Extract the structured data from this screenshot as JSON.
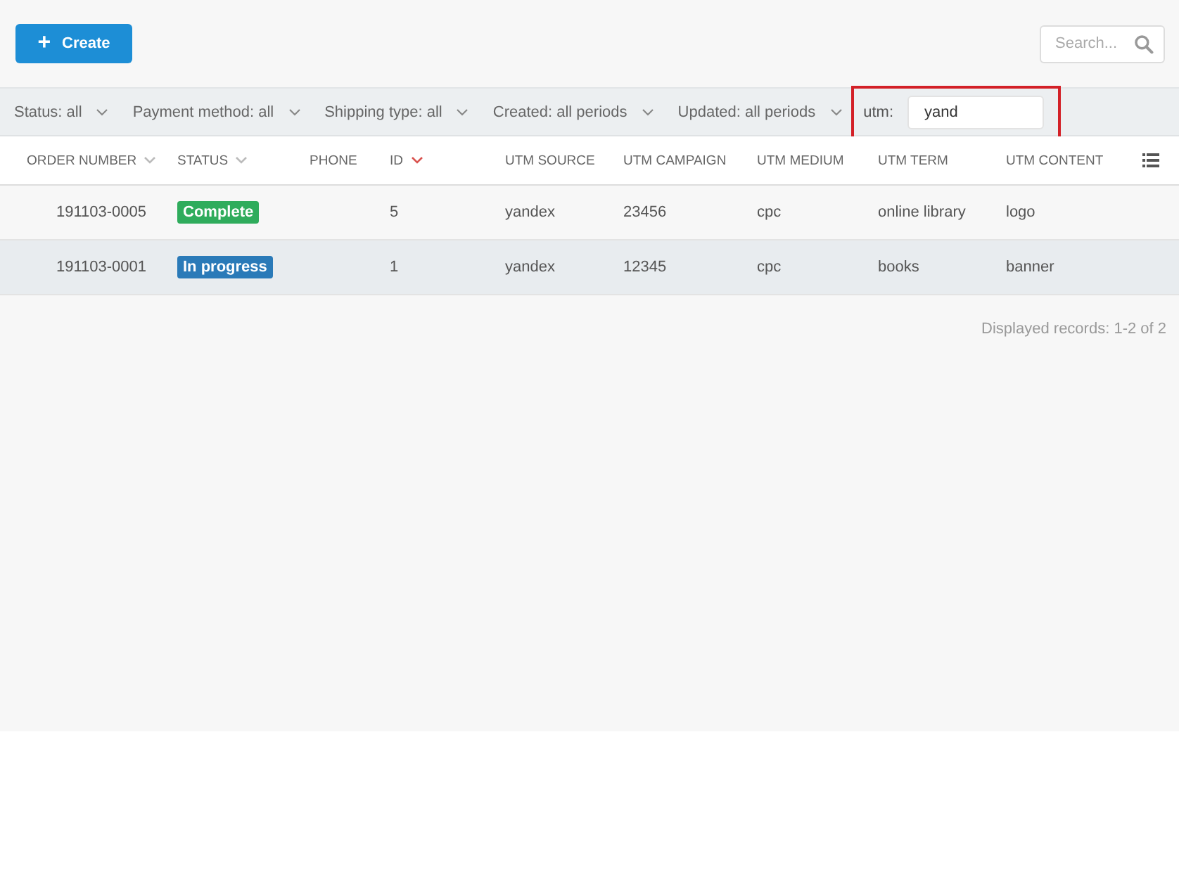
{
  "toolbar": {
    "create_button": {
      "icon": "+",
      "label": "Create"
    },
    "search": {
      "placeholder": "Search..."
    }
  },
  "filters": [
    {
      "label": "Status:",
      "value": "all",
      "kind": "dropdown"
    },
    {
      "label": "Payment method:",
      "value": "all",
      "kind": "dropdown"
    },
    {
      "label": "Shipping type:",
      "value": "all",
      "kind": "dropdown"
    },
    {
      "label": "Created:",
      "value": "all periods",
      "kind": "dropdown"
    },
    {
      "label": "Updated:",
      "value": "all periods",
      "kind": "dropdown"
    },
    {
      "label": "utm:",
      "value": "yand",
      "kind": "text",
      "highlighted": true
    }
  ],
  "table": {
    "columns": [
      {
        "label": "ORDER NUMBER",
        "sorted": false
      },
      {
        "label": "STATUS",
        "sorted": false
      },
      {
        "label": "PHONE"
      },
      {
        "label": "ID",
        "sorted": true
      },
      {
        "label": "UTM SOURCE"
      },
      {
        "label": "UTM CAMPAIGN"
      },
      {
        "label": "UTM MEDIUM"
      },
      {
        "label": "UTM TERM"
      },
      {
        "label": "UTM CONTENT"
      }
    ],
    "rows": [
      {
        "highlighted": false,
        "order_number": "191103-0005",
        "status": {
          "label": "Complete",
          "color": "#2fac5c"
        },
        "phone": "",
        "id": "5",
        "utm_source": "yandex",
        "utm_campaign": "23456",
        "utm_medium": "cpc",
        "utm_term": "online library",
        "utm_content": "logo"
      },
      {
        "highlighted": true,
        "order_number": "191103-0001",
        "status": {
          "label": "In progress",
          "color": "#2a7ab8"
        },
        "phone": "",
        "id": "1",
        "utm_source": "yandex",
        "utm_campaign": "12345",
        "utm_medium": "cpc",
        "utm_term": "books",
        "utm_content": "banner"
      }
    ]
  },
  "footer": {
    "records": "Displayed records: 1-2 of 2"
  }
}
